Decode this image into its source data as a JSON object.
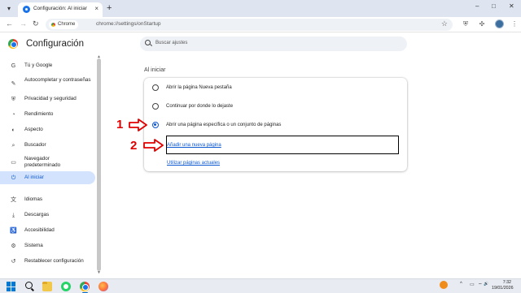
{
  "browser": {
    "tab_menu_icon": "chevron-down-icon",
    "tab_title": "Configuración: Al iniciar",
    "tab_close": "×",
    "new_tab": "+",
    "window_controls": [
      "–",
      "□",
      "✕"
    ],
    "nav": {
      "back": "←",
      "forward": "→",
      "reload": "↻"
    },
    "omnibox_chip": "Chrome",
    "url": "chrome://settings/onStartup",
    "bookmark_icon": "☆",
    "toolbar_icons": [
      "shield-icon",
      "puzzle-icon",
      "profile-avatar",
      "more-icon"
    ],
    "more": "⋮"
  },
  "settings": {
    "title": "Configuración",
    "search_placeholder": "Buscar ajustes"
  },
  "sidebar": {
    "items": [
      {
        "label": "Tú y Google",
        "icon": "G"
      },
      {
        "label": "Autocompletar y contraseñas",
        "icon": "✎"
      },
      {
        "label": "Privacidad y seguridad",
        "icon": "⛨"
      },
      {
        "label": "Rendimiento",
        "icon": "◔"
      },
      {
        "label": "Aspecto",
        "icon": "◐"
      },
      {
        "label": "Buscador",
        "icon": "⌕"
      },
      {
        "label": "Navegador predeterminado",
        "icon": "▭"
      },
      {
        "label": "Al iniciar",
        "icon": "⏻",
        "active": true
      },
      {
        "label": "Idiomas",
        "icon": "文"
      },
      {
        "label": "Descargas",
        "icon": "⤓"
      },
      {
        "label": "Accesibilidad",
        "icon": "♿"
      },
      {
        "label": "Sistema",
        "icon": "⚙"
      },
      {
        "label": "Restablecer configuración",
        "icon": "↺"
      }
    ]
  },
  "startup": {
    "section_title": "Al iniciar",
    "options": [
      {
        "label": "Abrir la página Nueva pestaña",
        "selected": false
      },
      {
        "label": "Continuar por donde lo dejaste",
        "selected": false
      },
      {
        "label": "Abrir una página específica o un conjunto de páginas",
        "selected": true
      }
    ],
    "add_page": "Añadir una nueva página",
    "use_current": "Utilizar páginas actuales"
  },
  "annotations": [
    {
      "number": "1",
      "color": "#e00000"
    },
    {
      "number": "2",
      "color": "#e00000"
    }
  ],
  "taskbar": {
    "apps": [
      "windows-icon",
      "search-icon",
      "files-icon",
      "whatsapp-icon",
      "chrome-icon",
      "firefox-icon"
    ],
    "tray": [
      "^",
      "▭",
      "⌔",
      "🔊"
    ],
    "time": "7:32",
    "date": "19/01/2026"
  }
}
